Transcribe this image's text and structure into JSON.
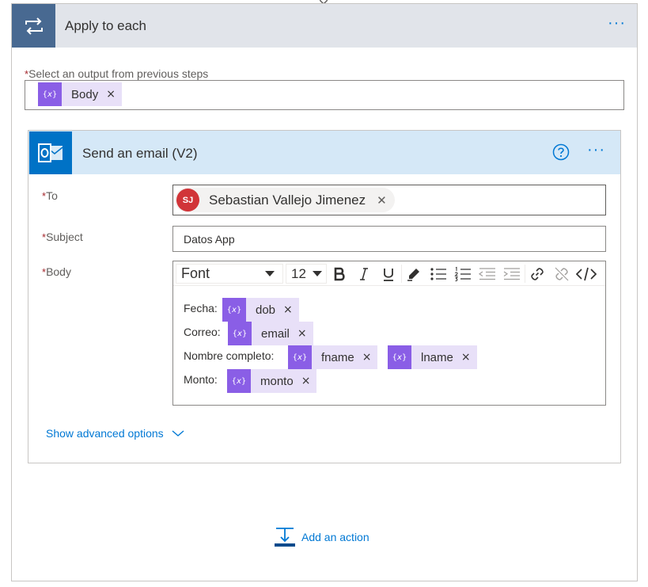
{
  "apply_to_each": {
    "title": "Apply to each",
    "more_label": "···",
    "select_required_mark": "*",
    "select_label": "Select an output from previous steps",
    "select_token": "Body",
    "remove_symbol": "×"
  },
  "send_email": {
    "title": "Send an email (V2)",
    "more_label": "···",
    "to": {
      "required_mark": "*",
      "label": "To",
      "avatar_initials": "SJ",
      "recipient": "Sebastian Vallejo Jimenez",
      "remove_symbol": "✕"
    },
    "subject": {
      "required_mark": "*",
      "label": "Subject",
      "value": "Datos App"
    },
    "body": {
      "required_mark": "*",
      "label": "Body",
      "toolbar": {
        "font": "Font",
        "size": "12"
      },
      "lines": [
        {
          "label": "Fecha:",
          "tokens": [
            "dob"
          ]
        },
        {
          "label": "Correo:",
          "tokens": [
            "email"
          ]
        },
        {
          "label": "Nombre completo:",
          "tokens": [
            "fname",
            "lname"
          ]
        },
        {
          "label": "Monto:",
          "tokens": [
            "monto"
          ]
        }
      ]
    },
    "advanced_label": "Show advanced options"
  },
  "add_action_label": "Add an action",
  "colors": {
    "accent": "#0078d4",
    "token_bg": "#e8e0f8",
    "token_icon": "#8a5ee6",
    "loop_header": "#486991",
    "outlook": "#0072c6",
    "avatar": "#d13438"
  }
}
